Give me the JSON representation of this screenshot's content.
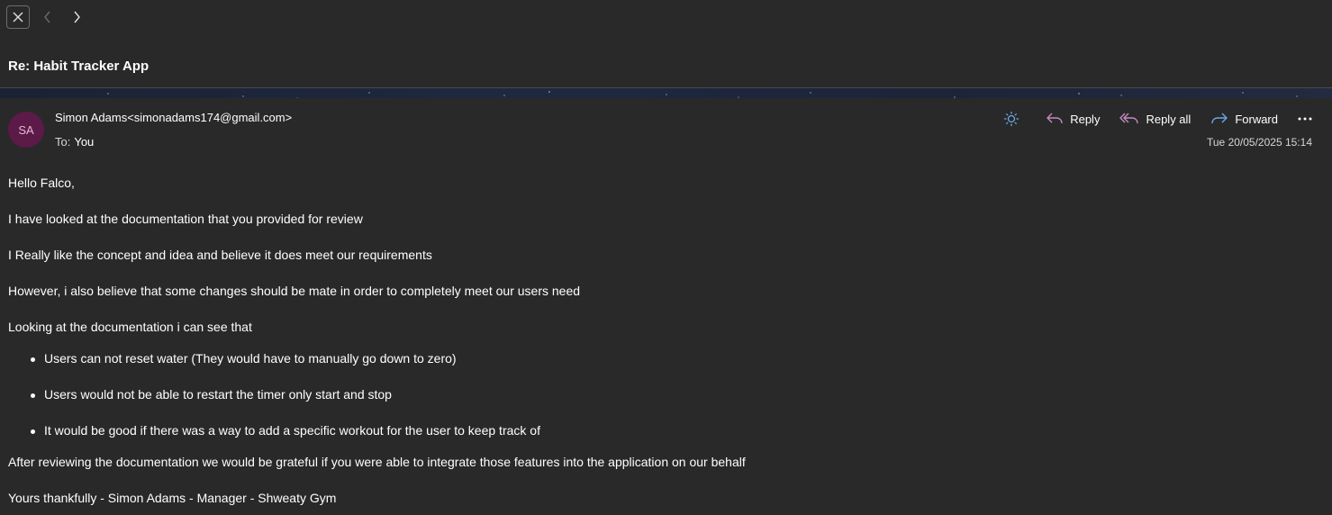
{
  "subject": "Re: Habit Tracker App",
  "sender": {
    "initials": "SA",
    "name_email": "Simon Adams<simonadams174@gmail.com>",
    "to_label": "To:",
    "to_value": "You",
    "date": "Tue 20/05/2025 15:14"
  },
  "actions": {
    "reply": "Reply",
    "reply_all": "Reply all",
    "forward": "Forward"
  },
  "body": {
    "greeting": "Hello Falco,",
    "p1": "I have looked at the documentation that you provided for review",
    "p2": "I Really like the concept and idea and believe it does meet our requirements",
    "p3": "However, i also believe that some changes should be mate in order to completely meet our users need",
    "p4": "Looking at the documentation i can see that",
    "bullets": [
      "Users can not reset water (They would have to manually go down to zero)",
      "Users would not be able to restart the timer only start and stop",
      "It would be good if there was a way to add a specific workout for the user to keep track of"
    ],
    "p5": "After reviewing the documentation we would be grateful if you were able to integrate those features into the application on our behalf",
    "signoff": "Yours thankfully - Simon Adams - Manager - Shweaty Gym"
  },
  "icons": {
    "close": "close-icon",
    "prev": "chevron-left-icon",
    "next": "chevron-right-icon",
    "theme": "sun-icon",
    "reply": "reply-icon",
    "reply_all": "reply-all-icon",
    "forward": "forward-icon",
    "more": "more-icon"
  },
  "colors": {
    "background": "#292929",
    "avatar": "#5c1a49",
    "reply_icon": "#c58ac0",
    "forward_icon": "#6aa8e8",
    "theme_icon": "#6aa8e8"
  }
}
